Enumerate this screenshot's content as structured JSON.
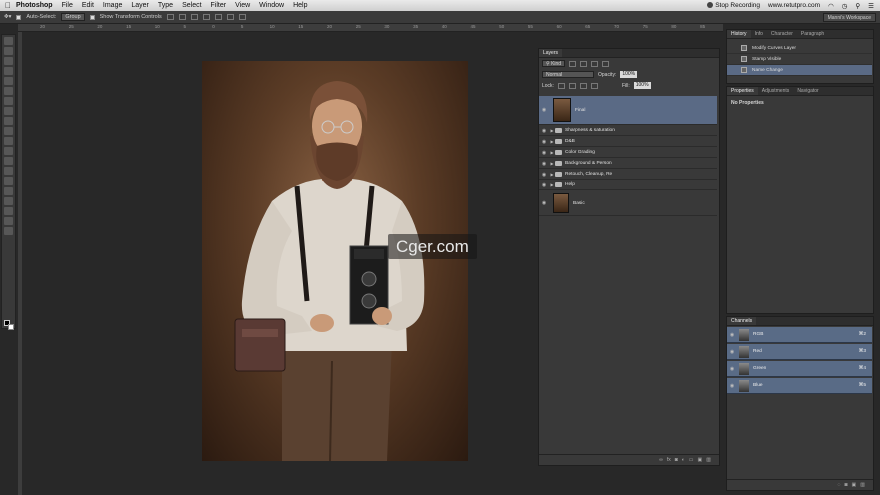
{
  "menubar": {
    "app": "Photoshop",
    "menus": [
      "File",
      "Edit",
      "Image",
      "Layer",
      "Type",
      "Select",
      "Filter",
      "View",
      "Window",
      "Help"
    ],
    "recording": "Stop Recording",
    "site": "www.retutpro.com"
  },
  "options": {
    "auto_select": "Auto-Select:",
    "group": "Group",
    "transform": "Show Transform Controls",
    "workspace": "Manni's Workspace"
  },
  "ruler": [
    "20",
    "25",
    "20",
    "15",
    "10",
    "5",
    "0",
    "5",
    "10",
    "15",
    "20",
    "25",
    "30",
    "35",
    "40",
    "45",
    "50",
    "55",
    "60",
    "65",
    "70",
    "75",
    "80",
    "85"
  ],
  "layers": {
    "tab": "Layers",
    "kind": "Kind",
    "blend": "Normal",
    "opacity_label": "Opacity:",
    "opacity": "100%",
    "lock_label": "Lock:",
    "fill_label": "Fill:",
    "fill": "100%",
    "items": [
      {
        "name": "Final",
        "type": "layer"
      },
      {
        "name": "Sharpness & saturation",
        "type": "group"
      },
      {
        "name": "D&B",
        "type": "group"
      },
      {
        "name": "Color Grading",
        "type": "group"
      },
      {
        "name": "Background & Person",
        "type": "group"
      },
      {
        "name": "Retouch, Cleanup, Re",
        "type": "group"
      },
      {
        "name": "Help",
        "type": "group"
      },
      {
        "name": "Basic",
        "type": "layer"
      }
    ],
    "footer": [
      "fx"
    ]
  },
  "history": {
    "tabs": [
      "History",
      "Info",
      "Character",
      "Paragraph"
    ],
    "items": [
      "Modify Curves Layer",
      "Stamp Visible",
      "Name Change"
    ]
  },
  "properties": {
    "tabs": [
      "Properties",
      "Adjustments",
      "Navigator"
    ],
    "text": "No Properties"
  },
  "channels": {
    "tab": "Channels",
    "items": [
      {
        "name": "RGB",
        "key": "⌘2"
      },
      {
        "name": "Red",
        "key": "⌘3"
      },
      {
        "name": "Green",
        "key": "⌘4"
      },
      {
        "name": "Blue",
        "key": "⌘5"
      }
    ]
  },
  "watermark": "Cger.com"
}
